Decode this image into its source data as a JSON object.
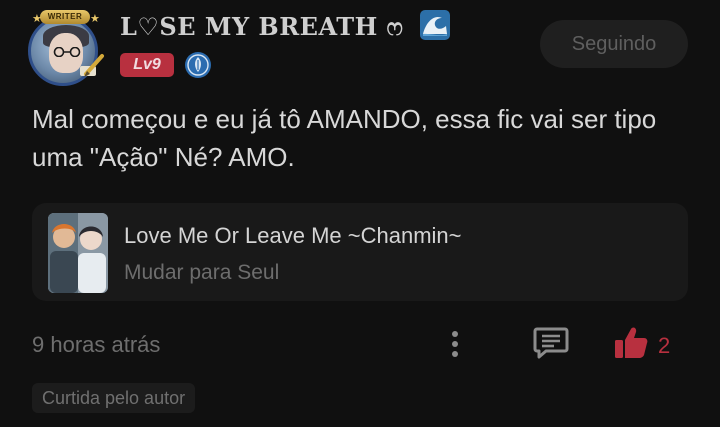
{
  "user": {
    "avatar_frame_label": "WRITER",
    "name": "L♡SE MY BREATH ෆ",
    "level": "Lv9",
    "icons": {
      "badge": "wave-icon",
      "rank": "shield-leaf-icon"
    }
  },
  "follow_button": {
    "label": "Seguindo"
  },
  "comment": {
    "text": "Mal começou e eu já tô AMANDO, essa fic vai ser tipo uma \"Ação\" Né? AMO."
  },
  "story": {
    "title": "Love Me Or Leave Me ~Chanmin~",
    "subtitle": "Mudar para Seul"
  },
  "footer": {
    "timestamp": "9 horas atrás",
    "like_count": "2",
    "liked_by_author": "Curtida pelo autor",
    "icons": {
      "more": "more-vertical-icon",
      "reply": "comment-icon",
      "like": "thumbs-up-icon"
    }
  },
  "colors": {
    "background": "#101010",
    "accent": "#b8303f",
    "card": "#191919",
    "muted_text": "#6e6e6e"
  }
}
